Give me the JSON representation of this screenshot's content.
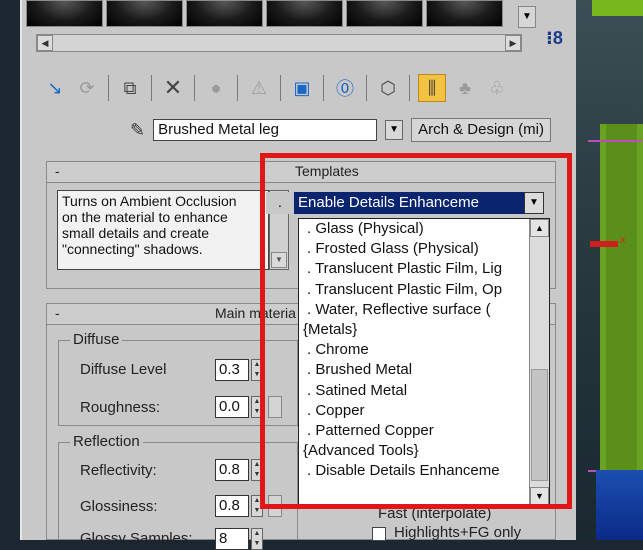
{
  "browser": {
    "material_name": "Brushed Metal leg",
    "material_type": "Arch & Design (mi)"
  },
  "toolbar": {
    "icons": [
      "get-material-icon",
      "put-material-icon",
      "assign-material-icon",
      "delete-icon",
      "copy-material-icon",
      "unique-icon",
      "put-library-icon",
      "material-id-icon",
      "show-map-icon",
      "show-end-result-icon",
      "go-parent-icon",
      "go-sibling-icon"
    ]
  },
  "templates": {
    "title": "Templates",
    "description": "Turns on Ambient Occlusion on the material to enhance small details and create \"connecting\" shadows.",
    "description_lines": [
      "Turns on Ambient Occlusion",
      "on the material to enhance",
      "small details and create",
      "\"connecting\" shadows."
    ],
    "selected": "Enable Details Enhanceme",
    "items": [
      ". Glass (Physical)",
      ". Frosted Glass (Physical)",
      ". Translucent Plastic Film, Lig",
      ". Translucent Plastic Film, Op",
      ". Water, Reflective surface (",
      "{Metals}",
      ". Chrome",
      ". Brushed Metal",
      ". Satined Metal",
      ". Copper",
      ". Patterned Copper",
      "{Advanced Tools}",
      ". Enable Details Enhanceme",
      ". Disable Details Enhanceme"
    ],
    "selected_index": 12
  },
  "main": {
    "title": "Main materia",
    "diffuse_group": "Diffuse",
    "diffuse_level_label": "Diffuse Level",
    "diffuse_level": "0.3",
    "roughness_label": "Roughness:",
    "roughness": "0.0",
    "reflection_group": "Reflection",
    "reflectivity_label": "Reflectivity:",
    "reflectivity": "0.8",
    "glossiness_label": "Glossiness:",
    "glossiness": "0.8",
    "glossy_samples_label": "Glossy Samples:",
    "glossy_samples": "8",
    "fast_interpolate": "Fast (interpolate)",
    "highlights_fg_only": "Highlights+FG only"
  },
  "colors": {
    "panel_bg": "#c8c8c8",
    "selection_bg": "#0a2470",
    "highlight_box": "#e01717",
    "active_button": "#f4c243"
  }
}
